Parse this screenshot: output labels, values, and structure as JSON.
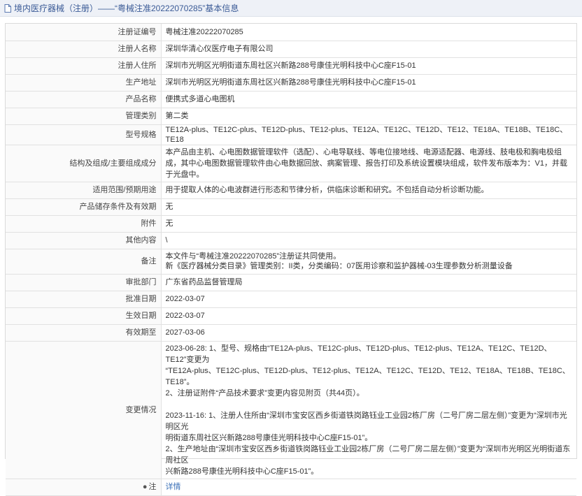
{
  "header": {
    "title": "境内医疗器械（注册）——“粤械注准20222070285”基本信息"
  },
  "rows": [
    {
      "label": "注册证编号",
      "value": "粤械注准20222070285"
    },
    {
      "label": "注册人名称",
      "value": "深圳华清心仪医疗电子有限公司"
    },
    {
      "label": "注册人住所",
      "value": "深圳市光明区光明街道东周社区兴新路288号康佳光明科技中心C座F15-01"
    },
    {
      "label": "生产地址",
      "value": "深圳市光明区光明街道东周社区兴新路288号康佳光明科技中心C座F15-01"
    },
    {
      "label": "产品名称",
      "value": "便携式多道心电图机"
    },
    {
      "label": "管理类别",
      "value": "第二类"
    },
    {
      "label": "型号规格",
      "value": "TE12A-plus、TE12C-plus、TE12D-plus、TE12-plus、TE12A、TE12C、TE12D、TE12、TE18A、TE18B、TE18C、TE18"
    },
    {
      "label": "结构及组成/主要组成成分",
      "value": "本产品由主机、心电图数据管理软件（选配）、心电导联线、等电位接地线、电源适配器、电源线、肢电极和胸电极组成，其中心电图数据管理软件由心电数据回放、病案管理、报告打印及系统设置模块组成，软件发布版本为：V1，并载于光盘中。"
    },
    {
      "label": "适用范围/预期用途",
      "value": "用于提取人体的心电波群进行形态和节律分析，供临床诊断和研究。不包括自动分析诊断功能。"
    },
    {
      "label": "产品储存条件及有效期",
      "value": "无"
    },
    {
      "label": "附件",
      "value": "无"
    },
    {
      "label": "其他内容",
      "value": "\\"
    }
  ],
  "remarks": {
    "label": "备注",
    "line1": "本文件与“粤械注准20222070285”注册证共同使用。",
    "line2": "新《医疗器械分类目录》管理类别：II类，分类编码：07医用诊察和监护器械-03生理参数分析测量设备"
  },
  "rows2": [
    {
      "label": "审批部门",
      "value": "广东省药品监督管理局"
    },
    {
      "label": "批准日期",
      "value": "2022-03-07"
    },
    {
      "label": "生效日期",
      "value": "2022-03-07"
    },
    {
      "label": "有效期至",
      "value": "2027-03-06"
    }
  ],
  "changes": {
    "label": "变更情况",
    "block1_l1": "2023-06-28: 1、型号、规格由“TE12A-plus、TE12C-plus、TE12D-plus、TE12-plus、TE12A、TE12C、TE12D、TE12”变更为",
    "block1_l2": "“TE12A-plus、TE12C-plus、TE12D-plus、TE12-plus、TE12A、TE12C、TE12D、TE12、TE18A、TE18B、TE18C、TE18”。",
    "block1_l3": "2、注册证附件“产品技术要求”变更内容见附页（共44页）。",
    "block2_l1": "2023-11-16: 1、注册人住所由“深圳市宝安区西乡街道铁岗路钰业工业园2栋厂房（二号厂房二层左侧）”变更为“深圳市光明区光",
    "block2_l2": "明街道东周社区兴新路288号康佳光明科技中心C座F15-01”。",
    "block2_l3": "2、生产地址由“深圳市宝安区西乡街道铁岗路钰业工业园2栋厂房（二号厂房二层左侧）”变更为“深圳市光明区光明街道东周社区",
    "block2_l4": "兴新路288号康佳光明科技中心C座F15-01”。"
  },
  "footer": {
    "label": "注",
    "link": "详情"
  }
}
